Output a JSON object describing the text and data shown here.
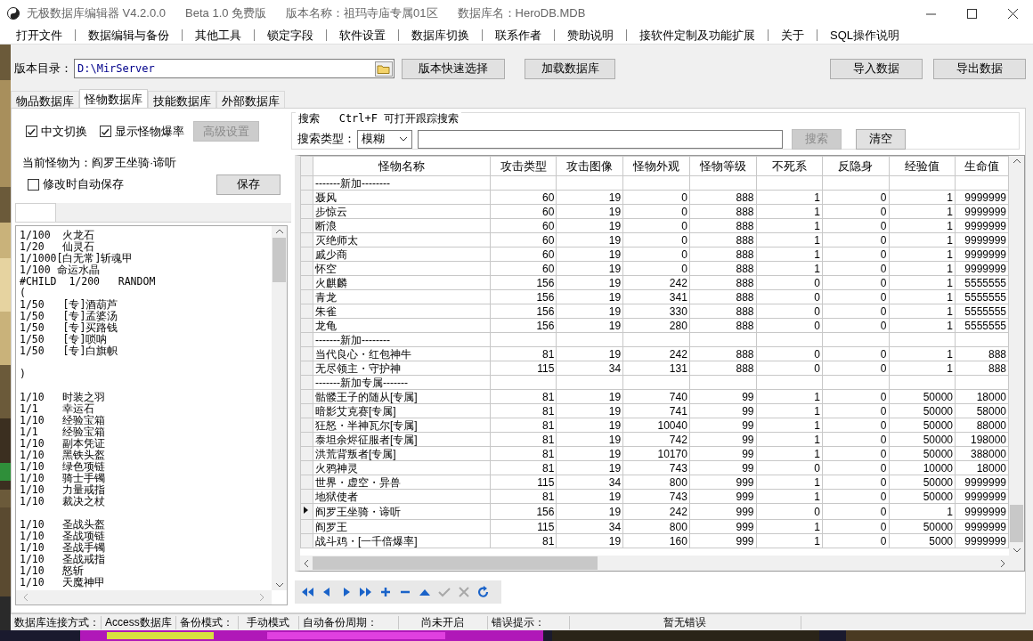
{
  "window": {
    "title": "无极数据库编辑器 V4.2.0.0",
    "edition": "Beta 1.0 免费版",
    "version_name": "版本名称：祖玛寺庙专属01区",
    "database_name": "数据库名：HeroDB.MDB"
  },
  "menu": [
    "打开文件",
    "数据编辑与备份",
    "其他工具",
    "锁定字段",
    "软件设置",
    "数据库切换",
    "联系作者",
    "赞助说明",
    "接软件定制及功能扩展",
    "关于",
    "SQL操作说明"
  ],
  "toolbar": {
    "directory_label": "版本目录：",
    "directory": "D:\\MirServer",
    "buttons": [
      "版本快速选择",
      "加载数据库"
    ],
    "right_buttons": [
      "导入数据",
      "导出数据"
    ]
  },
  "tabs": [
    {
      "label": "物品数据库",
      "selected": false
    },
    {
      "label": "怪物数据库",
      "selected": true
    },
    {
      "label": "技能数据库",
      "selected": false
    },
    {
      "label": "外部数据库",
      "selected": false
    }
  ],
  "options": {
    "checkboxes": [
      {
        "label": "中文切换",
        "checked": true
      },
      {
        "label": "显示怪物爆率",
        "checked": true
      }
    ],
    "advanced_button": {
      "label": "高级设置",
      "disabled": true
    }
  },
  "search": {
    "title": "搜索   Ctrl+F 可打开跟踪搜索",
    "type_label": "搜索类型：",
    "type_value": "模糊",
    "search_button": {
      "label": "搜索",
      "disabled": true
    },
    "clear_button": "清空"
  },
  "monster_panel": {
    "current": "当前怪物为：阎罗王坐骑·谛听",
    "autosave": {
      "label": "修改时自动保存",
      "checked": false
    },
    "save_button": "保存",
    "drop_blocks": [
      [
        "1/100  火龙石",
        "1/20   仙灵石",
        "1/1000[白无常]斩魂甲",
        "1/100 命运水晶",
        "#CHILD  1/200   RANDOM",
        "(",
        "1/50   [专]酒葫芦",
        "1/50   [专]孟婆汤",
        "1/50   [专]买路钱",
        "1/50   [专]唢呐",
        "1/50   [专]白旗帜"
      ],
      [
        ")"
      ],
      [
        "1/10   时装之羽",
        "1/1    幸运石",
        "1/10   经验宝箱",
        "1/1    经验宝箱",
        "1/10   副本凭证",
        "1/10   黑铁头盔",
        "1/10   绿色项链",
        "1/10   骑士手镯",
        "1/10   力量戒指",
        "1/10   裁决之杖"
      ],
      [
        "1/10   圣战头盔",
        "1/10   圣战项链",
        "1/10   圣战手镯",
        "1/10   圣战戒指",
        "1/10   怒斩",
        "1/10   天魔神甲"
      ]
    ]
  },
  "table": {
    "columns": [
      "怪物名称",
      "攻击类型",
      "攻击图像",
      "怪物外观",
      "怪物等级",
      "不死系",
      "反隐身",
      "经验值",
      "生命值"
    ],
    "rows": [
      {
        "kind": "section",
        "selected": false,
        "cells": [
          "-------新加--------"
        ]
      },
      {
        "kind": "data",
        "selected": false,
        "cells": [
          "聂风",
          "60",
          "19",
          "0",
          "888",
          "1",
          "0",
          "1",
          "9999999"
        ]
      },
      {
        "kind": "data",
        "selected": false,
        "cells": [
          "步惊云",
          "60",
          "19",
          "0",
          "888",
          "1",
          "0",
          "1",
          "9999999"
        ]
      },
      {
        "kind": "data",
        "selected": false,
        "cells": [
          "断浪",
          "60",
          "19",
          "0",
          "888",
          "1",
          "0",
          "1",
          "9999999"
        ]
      },
      {
        "kind": "data",
        "selected": false,
        "cells": [
          "灭绝师太",
          "60",
          "19",
          "0",
          "888",
          "1",
          "0",
          "1",
          "9999999"
        ]
      },
      {
        "kind": "data",
        "selected": false,
        "cells": [
          "戚少商",
          "60",
          "19",
          "0",
          "888",
          "1",
          "0",
          "1",
          "9999999"
        ]
      },
      {
        "kind": "data",
        "selected": false,
        "cells": [
          "怀空",
          "60",
          "19",
          "0",
          "888",
          "1",
          "0",
          "1",
          "9999999"
        ]
      },
      {
        "kind": "data",
        "selected": false,
        "cells": [
          "火麒麟",
          "156",
          "19",
          "242",
          "888",
          "0",
          "0",
          "1",
          "5555555"
        ]
      },
      {
        "kind": "data",
        "selected": false,
        "cells": [
          "青龙",
          "156",
          "19",
          "341",
          "888",
          "0",
          "0",
          "1",
          "5555555"
        ]
      },
      {
        "kind": "data",
        "selected": false,
        "cells": [
          "朱雀",
          "156",
          "19",
          "330",
          "888",
          "0",
          "0",
          "1",
          "5555555"
        ]
      },
      {
        "kind": "data",
        "selected": false,
        "cells": [
          "龙龟",
          "156",
          "19",
          "280",
          "888",
          "0",
          "0",
          "1",
          "5555555"
        ]
      },
      {
        "kind": "section",
        "selected": false,
        "cells": [
          "-------新加--------"
        ]
      },
      {
        "kind": "data",
        "selected": false,
        "cells": [
          "当代良心・红包神牛",
          "81",
          "19",
          "242",
          "888",
          "0",
          "0",
          "1",
          "888"
        ]
      },
      {
        "kind": "data",
        "selected": false,
        "cells": [
          "无尽领主・守护神",
          "115",
          "34",
          "131",
          "888",
          "0",
          "0",
          "1",
          "888"
        ]
      },
      {
        "kind": "section",
        "selected": false,
        "cells": [
          "-------新加专属-------"
        ]
      },
      {
        "kind": "data",
        "selected": false,
        "cells": [
          "骷髅王子的随从[专属]",
          "81",
          "19",
          "740",
          "99",
          "1",
          "0",
          "50000",
          "18000"
        ]
      },
      {
        "kind": "data",
        "selected": false,
        "cells": [
          "暗影艾克赛[专属]",
          "81",
          "19",
          "741",
          "99",
          "1",
          "0",
          "50000",
          "58000"
        ]
      },
      {
        "kind": "data",
        "selected": false,
        "cells": [
          "狂怒・半神瓦尔[专属]",
          "81",
          "19",
          "10040",
          "99",
          "1",
          "0",
          "50000",
          "88000"
        ]
      },
      {
        "kind": "data",
        "selected": false,
        "cells": [
          "泰坦余烬征服者[专属]",
          "81",
          "19",
          "742",
          "99",
          "1",
          "0",
          "50000",
          "198000"
        ]
      },
      {
        "kind": "data",
        "selected": false,
        "cells": [
          "洪荒背叛者[专属]",
          "81",
          "19",
          "10170",
          "99",
          "1",
          "0",
          "50000",
          "388000"
        ]
      },
      {
        "kind": "data",
        "selected": false,
        "cells": [
          "火鸦神灵",
          "81",
          "19",
          "743",
          "99",
          "0",
          "0",
          "10000",
          "18000"
        ]
      },
      {
        "kind": "data",
        "selected": false,
        "cells": [
          "世界・虚空・异兽",
          "115",
          "34",
          "800",
          "999",
          "1",
          "0",
          "50000",
          "9999999"
        ]
      },
      {
        "kind": "data",
        "selected": false,
        "cells": [
          "地狱使者",
          "81",
          "19",
          "743",
          "999",
          "1",
          "0",
          "50000",
          "9999999"
        ]
      },
      {
        "kind": "data",
        "selected": true,
        "cells": [
          "阎罗王坐骑・谛听",
          "156",
          "19",
          "242",
          "999",
          "0",
          "0",
          "1",
          "9999999"
        ]
      },
      {
        "kind": "data",
        "selected": false,
        "cells": [
          "阎罗王",
          "115",
          "34",
          "800",
          "999",
          "1",
          "0",
          "50000",
          "9999999"
        ]
      },
      {
        "kind": "data",
        "selected": false,
        "cells": [
          "战斗鸡・[一千倍爆率]",
          "81",
          "19",
          "160",
          "999",
          "1",
          "0",
          "5000",
          "9999999"
        ]
      }
    ]
  },
  "navigator": [
    {
      "kind": "first",
      "disabled": false
    },
    {
      "kind": "prior",
      "disabled": false
    },
    {
      "kind": "next",
      "disabled": false
    },
    {
      "kind": "last",
      "disabled": false
    },
    {
      "kind": "insert",
      "disabled": false
    },
    {
      "kind": "delete",
      "disabled": false
    },
    {
      "kind": "edit",
      "disabled": false
    },
    {
      "kind": "post",
      "disabled": true
    },
    {
      "kind": "cancel",
      "disabled": true
    },
    {
      "kind": "refresh",
      "disabled": false
    }
  ],
  "status_bar": [
    {
      "label": "数据库连接方式：",
      "value": "Access数据库"
    },
    {
      "label": "备份模式：",
      "value": "手动模式"
    },
    {
      "label": "自动备份周期：",
      "value": "尚未开启"
    },
    {
      "label": "错误提示：",
      "value": "暂无错误"
    }
  ]
}
